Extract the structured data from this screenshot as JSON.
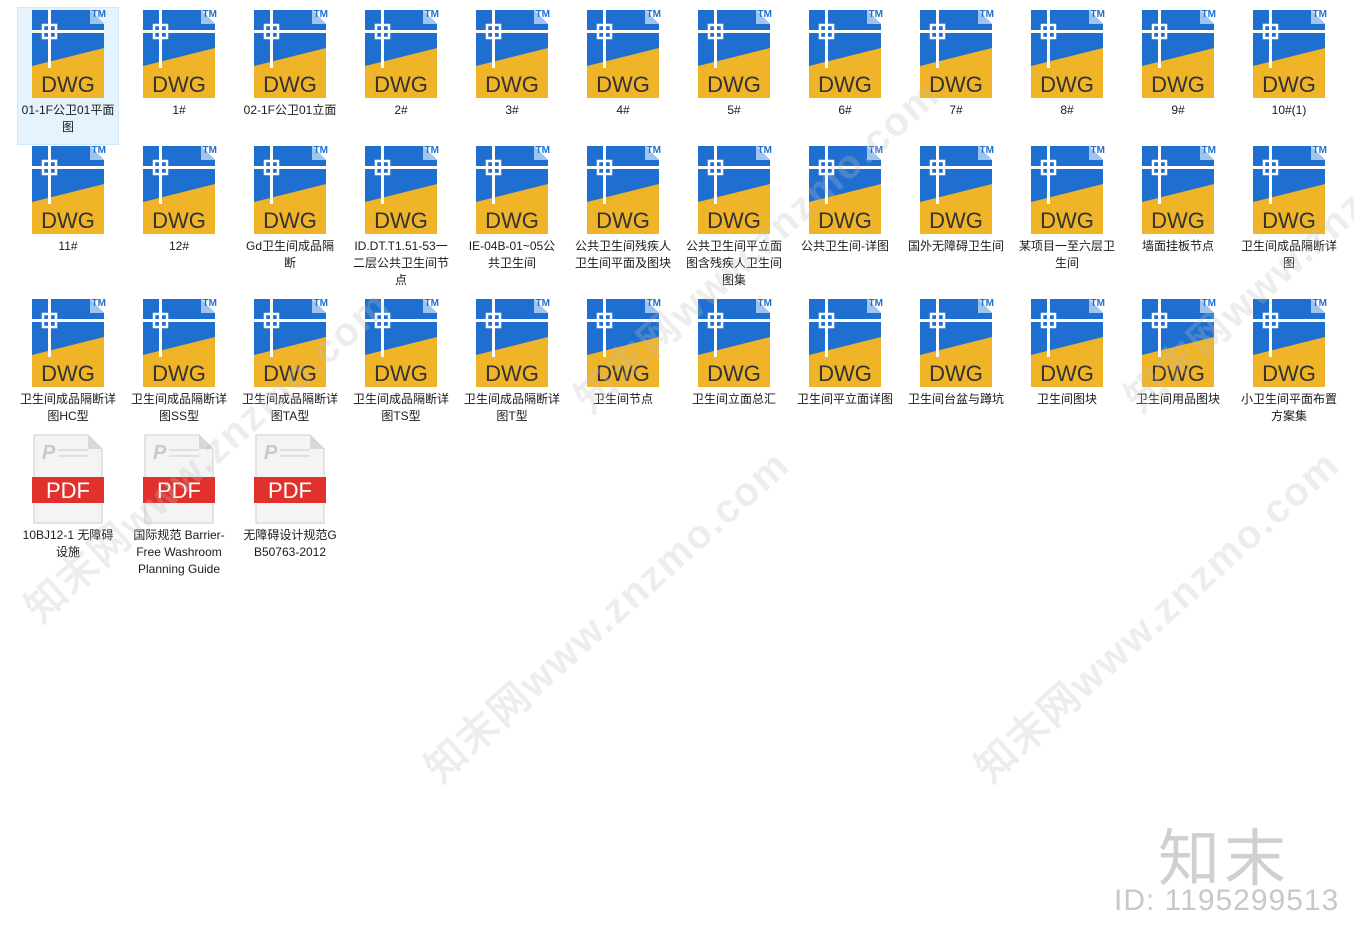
{
  "icons": {
    "dwg": {
      "name": "dwg-file-icon",
      "badge_text": "DWG",
      "tm_text": "TM",
      "blue": "#1e6fcf",
      "yellow": "#f0b429"
    },
    "pdf": {
      "name": "pdf-file-icon",
      "badge_text": "PDF",
      "red": "#e0312d"
    }
  },
  "files": [
    {
      "label": "01-1F公卫01平面图",
      "type": "dwg",
      "selected": true
    },
    {
      "label": "1#",
      "type": "dwg"
    },
    {
      "label": "02-1F公卫01立面",
      "type": "dwg"
    },
    {
      "label": "2#",
      "type": "dwg"
    },
    {
      "label": "3#",
      "type": "dwg"
    },
    {
      "label": "4#",
      "type": "dwg"
    },
    {
      "label": "5#",
      "type": "dwg"
    },
    {
      "label": "6#",
      "type": "dwg"
    },
    {
      "label": "7#",
      "type": "dwg"
    },
    {
      "label": "8#",
      "type": "dwg"
    },
    {
      "label": "9#",
      "type": "dwg"
    },
    {
      "label": "10#(1)",
      "type": "dwg"
    },
    {
      "label": "11#",
      "type": "dwg"
    },
    {
      "label": "12#",
      "type": "dwg"
    },
    {
      "label": "Gd卫生间成品隔断",
      "type": "dwg"
    },
    {
      "label": "ID.DT.T1.51-53一二层公共卫生间节点",
      "type": "dwg"
    },
    {
      "label": "IE-04B-01~05公共卫生间",
      "type": "dwg"
    },
    {
      "label": "公共卫生间残疾人卫生间平面及图块",
      "type": "dwg"
    },
    {
      "label": "公共卫生间平立面图含残疾人卫生间图集",
      "type": "dwg"
    },
    {
      "label": "公共卫生间-详图",
      "type": "dwg"
    },
    {
      "label": "国外无障碍卫生间",
      "type": "dwg"
    },
    {
      "label": "某项目一至六层卫生间",
      "type": "dwg"
    },
    {
      "label": "墙面挂板节点",
      "type": "dwg"
    },
    {
      "label": "卫生间成品隔断详图",
      "type": "dwg"
    },
    {
      "label": "卫生间成品隔断详图HC型",
      "type": "dwg"
    },
    {
      "label": "卫生间成品隔断详图SS型",
      "type": "dwg"
    },
    {
      "label": "卫生间成品隔断详图TA型",
      "type": "dwg"
    },
    {
      "label": "卫生间成品隔断详图TS型",
      "type": "dwg"
    },
    {
      "label": "卫生间成品隔断详图T型",
      "type": "dwg"
    },
    {
      "label": "卫生间节点",
      "type": "dwg"
    },
    {
      "label": "卫生间立面总汇",
      "type": "dwg"
    },
    {
      "label": "卫生间平立面详图",
      "type": "dwg"
    },
    {
      "label": "卫生间台盆与蹲坑",
      "type": "dwg"
    },
    {
      "label": "卫生间图块",
      "type": "dwg"
    },
    {
      "label": "卫生间用品图块",
      "type": "dwg"
    },
    {
      "label": "小卫生间平面布置方案集",
      "type": "dwg"
    },
    {
      "label": "10BJ12-1 无障碍设施",
      "type": "pdf"
    },
    {
      "label": "国际规范 Barrier-Free Washroom Planning Guide",
      "type": "pdf"
    },
    {
      "label": "无障碍设计规范GB50763-2012",
      "type": "pdf"
    }
  ],
  "watermark": {
    "text": "知末网www.znzmo.com"
  },
  "brand": {
    "logo_text": "知末",
    "id_text": "ID: 1195299513"
  }
}
